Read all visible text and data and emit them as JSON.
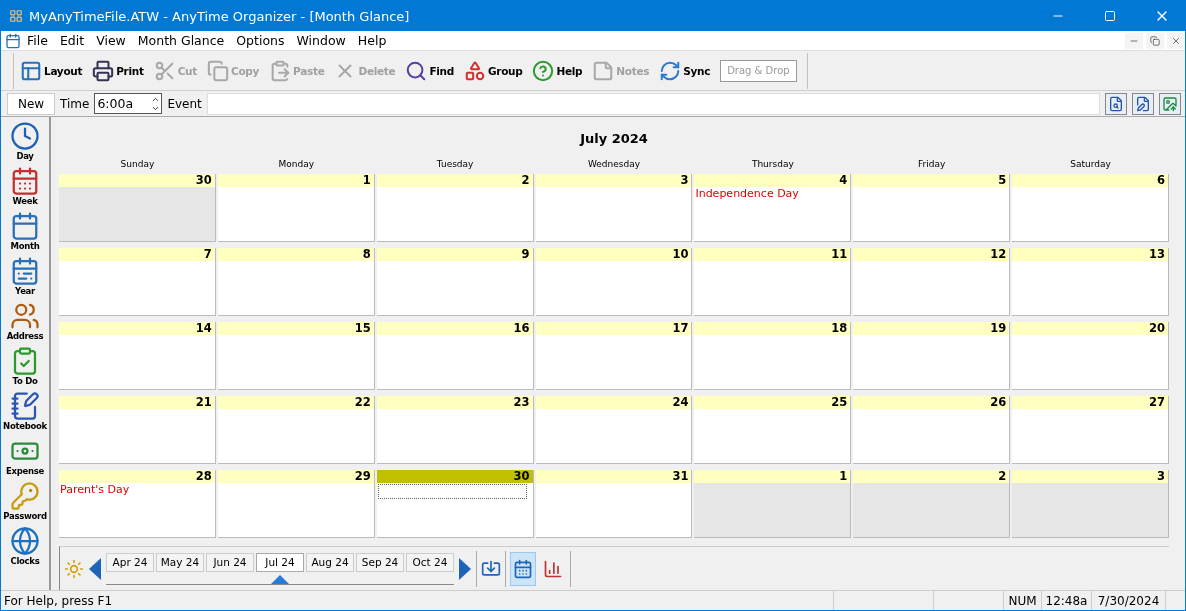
{
  "window": {
    "title": "MyAnyTimeFile.ATW - AnyTime Organizer - [Month Glance]"
  },
  "menu": [
    "File",
    "Edit",
    "View",
    "Month Glance",
    "Options",
    "Window",
    "Help"
  ],
  "toolbar": [
    {
      "label": "Layout",
      "kind": "button",
      "disabled": false
    },
    {
      "label": "Print",
      "kind": "button",
      "disabled": false
    },
    {
      "label": "Cut",
      "kind": "button",
      "disabled": true
    },
    {
      "label": "Copy",
      "kind": "button",
      "disabled": true
    },
    {
      "label": "Paste",
      "kind": "button",
      "disabled": true
    },
    {
      "label": "Delete",
      "kind": "button",
      "disabled": true
    },
    {
      "label": "Find",
      "kind": "button",
      "disabled": false
    },
    {
      "label": "Group",
      "kind": "button",
      "disabled": false
    },
    {
      "label": "Help",
      "kind": "button",
      "disabled": false
    },
    {
      "label": "Notes",
      "kind": "button",
      "disabled": true
    },
    {
      "label": "Sync",
      "kind": "button",
      "disabled": false
    },
    {
      "label": "Drag & Drop",
      "kind": "dropzone",
      "disabled": true
    }
  ],
  "entry": {
    "new_button": "New",
    "time_label": "Time",
    "time_value": "6:00a",
    "event_label": "Event"
  },
  "sidebar": [
    "Day",
    "Week",
    "Month",
    "Year",
    "Address",
    "To Do",
    "Notebook",
    "Expense",
    "Password",
    "Clocks"
  ],
  "calendar": {
    "title": "July 2024",
    "weekdays": [
      "Sunday",
      "Monday",
      "Tuesday",
      "Wednesday",
      "Thursday",
      "Friday",
      "Saturday"
    ],
    "days": [
      {
        "number": "30",
        "other_month": true,
        "selected": false
      },
      {
        "number": "1",
        "other_month": false,
        "selected": false
      },
      {
        "number": "2",
        "other_month": false,
        "selected": false
      },
      {
        "number": "3",
        "other_month": false,
        "selected": false
      },
      {
        "number": "4",
        "other_month": false,
        "selected": false,
        "events": [
          "Independence Day"
        ]
      },
      {
        "number": "5",
        "other_month": false,
        "selected": false
      },
      {
        "number": "6",
        "other_month": false,
        "selected": false
      },
      {
        "number": "7",
        "other_month": false,
        "selected": false
      },
      {
        "number": "8",
        "other_month": false,
        "selected": false
      },
      {
        "number": "9",
        "other_month": false,
        "selected": false
      },
      {
        "number": "10",
        "other_month": false,
        "selected": false
      },
      {
        "number": "11",
        "other_month": false,
        "selected": false
      },
      {
        "number": "12",
        "other_month": false,
        "selected": false
      },
      {
        "number": "13",
        "other_month": false,
        "selected": false
      },
      {
        "number": "14",
        "other_month": false,
        "selected": false
      },
      {
        "number": "15",
        "other_month": false,
        "selected": false
      },
      {
        "number": "16",
        "other_month": false,
        "selected": false
      },
      {
        "number": "17",
        "other_month": false,
        "selected": false
      },
      {
        "number": "18",
        "other_month": false,
        "selected": false
      },
      {
        "number": "19",
        "other_month": false,
        "selected": false
      },
      {
        "number": "20",
        "other_month": false,
        "selected": false
      },
      {
        "number": "21",
        "other_month": false,
        "selected": false
      },
      {
        "number": "22",
        "other_month": false,
        "selected": false
      },
      {
        "number": "23",
        "other_month": false,
        "selected": false
      },
      {
        "number": "24",
        "other_month": false,
        "selected": false
      },
      {
        "number": "25",
        "other_month": false,
        "selected": false
      },
      {
        "number": "26",
        "other_month": false,
        "selected": false
      },
      {
        "number": "27",
        "other_month": false,
        "selected": false
      },
      {
        "number": "28",
        "other_month": false,
        "selected": false,
        "events": [
          "Parent's Day"
        ]
      },
      {
        "number": "29",
        "other_month": false,
        "selected": false
      },
      {
        "number": "30",
        "other_month": false,
        "selected": true
      },
      {
        "number": "31",
        "other_month": false,
        "selected": false
      },
      {
        "number": "1",
        "other_month": true,
        "selected": false
      },
      {
        "number": "2",
        "other_month": true,
        "selected": false
      },
      {
        "number": "3",
        "other_month": true,
        "selected": false
      }
    ]
  },
  "months": [
    {
      "label": "Apr 24",
      "selected": false
    },
    {
      "label": "May 24",
      "selected": false
    },
    {
      "label": "Jun 24",
      "selected": false
    },
    {
      "label": "Jul 24",
      "selected": true
    },
    {
      "label": "Aug 24",
      "selected": false
    },
    {
      "label": "Sep 24",
      "selected": false
    },
    {
      "label": "Oct 24",
      "selected": false
    }
  ],
  "views": [
    {
      "kind": "calendar",
      "selected": true
    },
    {
      "kind": "chart",
      "selected": false
    }
  ],
  "status_bar": {
    "message": "For Help, press F1",
    "indicator": "NUM",
    "time": "12:48a",
    "date": "7/30/2024"
  }
}
